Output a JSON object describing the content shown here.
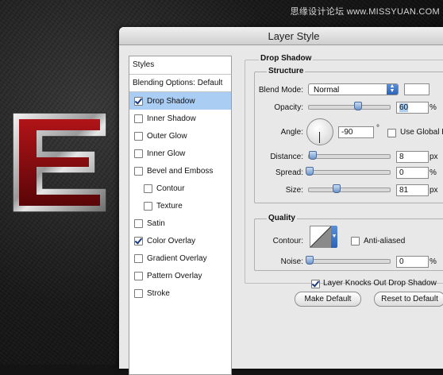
{
  "watermark": "思缘设计论坛 www.MISSYUAN.COM",
  "dialog": {
    "title": "Layer Style"
  },
  "styles_panel": {
    "header": "Styles",
    "blending_options": "Blending Options: Default",
    "items": [
      {
        "label": "Drop Shadow",
        "checked": true,
        "selected": true,
        "sub": false
      },
      {
        "label": "Inner Shadow",
        "checked": false,
        "selected": false,
        "sub": false
      },
      {
        "label": "Outer Glow",
        "checked": false,
        "selected": false,
        "sub": false
      },
      {
        "label": "Inner Glow",
        "checked": false,
        "selected": false,
        "sub": false
      },
      {
        "label": "Bevel and Emboss",
        "checked": false,
        "selected": false,
        "sub": false
      },
      {
        "label": "Contour",
        "checked": false,
        "selected": false,
        "sub": true
      },
      {
        "label": "Texture",
        "checked": false,
        "selected": false,
        "sub": true
      },
      {
        "label": "Satin",
        "checked": false,
        "selected": false,
        "sub": false
      },
      {
        "label": "Color Overlay",
        "checked": true,
        "selected": false,
        "sub": false
      },
      {
        "label": "Gradient Overlay",
        "checked": false,
        "selected": false,
        "sub": false
      },
      {
        "label": "Pattern Overlay",
        "checked": false,
        "selected": false,
        "sub": false
      },
      {
        "label": "Stroke",
        "checked": false,
        "selected": false,
        "sub": false
      }
    ]
  },
  "drop_shadow": {
    "title": "Drop Shadow",
    "structure": {
      "title": "Structure",
      "blend_mode_label": "Blend Mode:",
      "blend_mode_value": "Normal",
      "opacity_label": "Opacity:",
      "opacity_value": "60",
      "opacity_unit": "%",
      "opacity_level": 0.6,
      "angle_label": "Angle:",
      "angle_value": "-90",
      "angle_unit": "°",
      "use_global_light": "Use Global L",
      "distance_label": "Distance:",
      "distance_value": "8",
      "distance_unit": "px",
      "distance_level": 0.04,
      "spread_label": "Spread:",
      "spread_value": "0",
      "spread_unit": "%",
      "spread_level": 0.0,
      "size_label": "Size:",
      "size_value": "81",
      "size_unit": "px",
      "size_level": 0.33
    },
    "quality": {
      "title": "Quality",
      "contour_label": "Contour:",
      "anti_aliased": "Anti-aliased",
      "noise_label": "Noise:",
      "noise_value": "0",
      "noise_unit": "%",
      "noise_level": 0.0
    },
    "layer_knocks_out": "Layer Knocks Out Drop Shadow",
    "make_default": "Make Default",
    "reset_to_default": "Reset to Default"
  },
  "colors": {
    "accent": "#2c63b6",
    "selection": "#a9cdf3",
    "letter_red": "#8a0a10"
  }
}
